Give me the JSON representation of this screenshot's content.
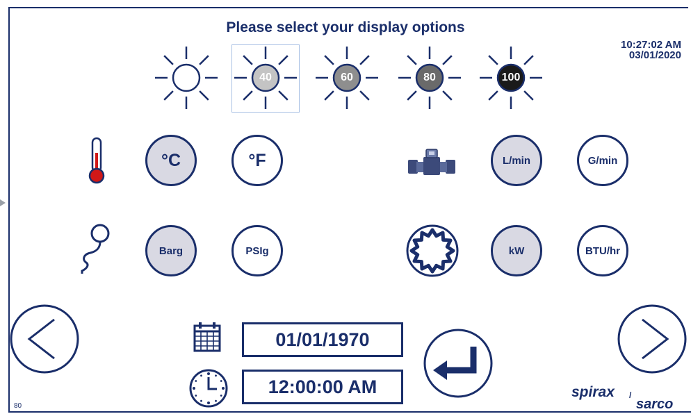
{
  "header": {
    "title": "Please select your display options",
    "time": "10:27:02 AM",
    "date": "03/01/2020"
  },
  "brightness": {
    "options": [
      {
        "label": "",
        "fill": "#ffffff"
      },
      {
        "label": "40",
        "fill": "#c4c4c4"
      },
      {
        "label": "60",
        "fill": "#8e8e8e"
      },
      {
        "label": "80",
        "fill": "#6a6a6a"
      },
      {
        "label": "100",
        "fill": "#1a1a1a"
      }
    ],
    "selected_index": 1
  },
  "units": {
    "temperature": {
      "options": [
        "°C",
        "°F"
      ],
      "selected": "°C"
    },
    "flow": {
      "options": [
        "L/min",
        "G/min"
      ],
      "selected": "L/min"
    },
    "pressure": {
      "options": [
        "Barg",
        "PSIg"
      ],
      "selected": "Barg"
    },
    "energy": {
      "options": [
        "kW",
        "BTU/hr"
      ],
      "selected": "kW"
    }
  },
  "datetime_entry": {
    "date_value": "01/01/1970",
    "time_value": "12:00:00 AM"
  },
  "footer": {
    "page_number": "80",
    "brand_top": "spirax",
    "brand_bottom": "sarco"
  },
  "colors": {
    "primary": "#1a2e6a",
    "selected_fill": "#d9d9e3",
    "thermometer_red": "#d01818"
  },
  "icons": [
    "thermometer-icon",
    "flowmeter-icon",
    "pressure-gauge-icon",
    "sun-gear-icon",
    "calendar-icon",
    "clock-icon",
    "enter-icon",
    "chevron-left-icon",
    "chevron-right-icon"
  ]
}
